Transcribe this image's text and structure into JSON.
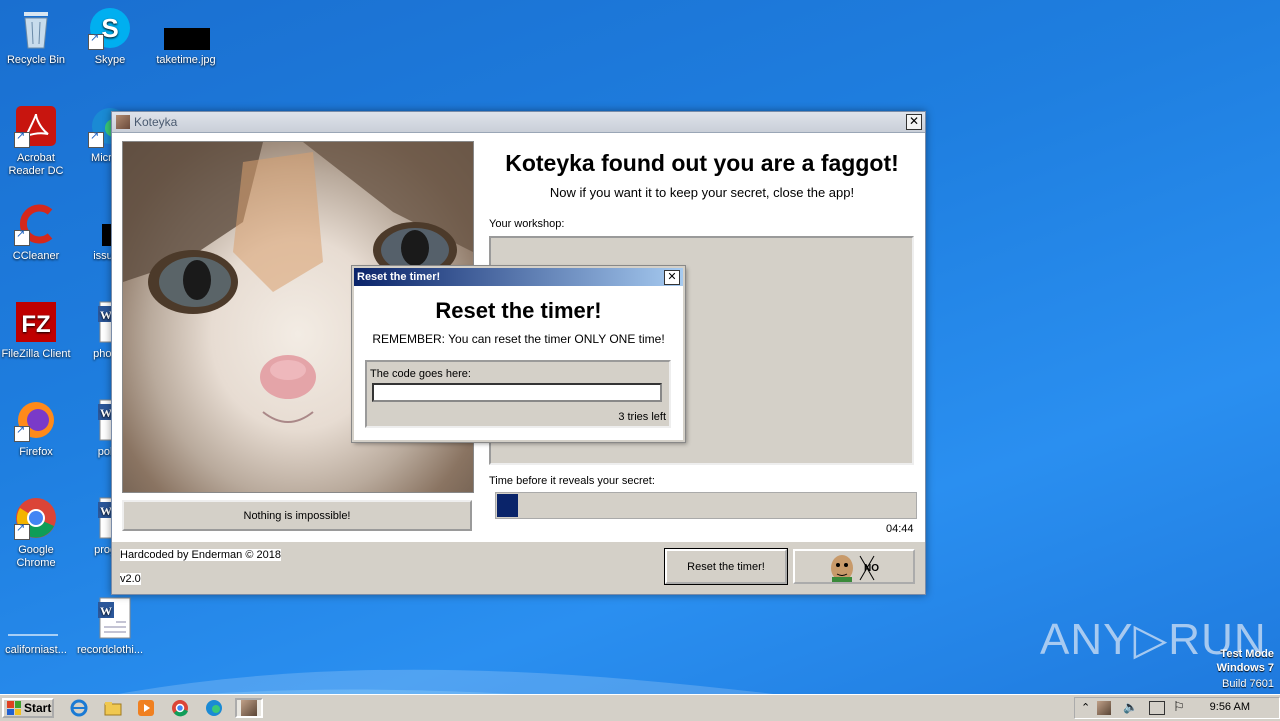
{
  "desktop": {
    "icons": [
      {
        "label": "Recycle Bin"
      },
      {
        "label": "Skype"
      },
      {
        "label": "taketime.jpg"
      },
      {
        "label": "Acrobat Reader DC"
      },
      {
        "label": "Microsc"
      },
      {
        "label": "CCleaner"
      },
      {
        "label": "issuesi"
      },
      {
        "label": "FileZilla Client"
      },
      {
        "label": "photog"
      },
      {
        "label": "Firefox"
      },
      {
        "label": "pobu"
      },
      {
        "label": "Google Chrome"
      },
      {
        "label": "progre"
      },
      {
        "label": "californiast..."
      },
      {
        "label": "recordclothi..."
      }
    ]
  },
  "window": {
    "title": "Koteyka",
    "close_glyph": "✕",
    "heading": "Koteyka found out you are a faggot!",
    "subheading": "Now if you want it to keep your secret, close the app!",
    "workshop_label": "Your workshop:",
    "timer_label": "Time before it reveals your secret:",
    "timer_value": "04:44",
    "progress_fraction": 0.055,
    "nothing_button": "Nothing is impossible!",
    "credit": "Hardcoded by Enderman © 2018",
    "version": "v2.0",
    "reset_button": "Reset the timer!"
  },
  "dialog": {
    "title": "Reset the timer!",
    "close_glyph": "✕",
    "heading": "Reset the timer!",
    "remember": "REMEMBER: You can reset the timer ONLY ONE time!",
    "code_label": "The code goes here:",
    "code_value": "",
    "tries": "3 tries left"
  },
  "taskbar": {
    "start_label": "Start",
    "clock": "9:56 AM"
  },
  "watermark": {
    "brand": "ANY▷RUN",
    "line1": "Test Mode",
    "line2": "Windows 7",
    "line3": "Build 7601"
  }
}
